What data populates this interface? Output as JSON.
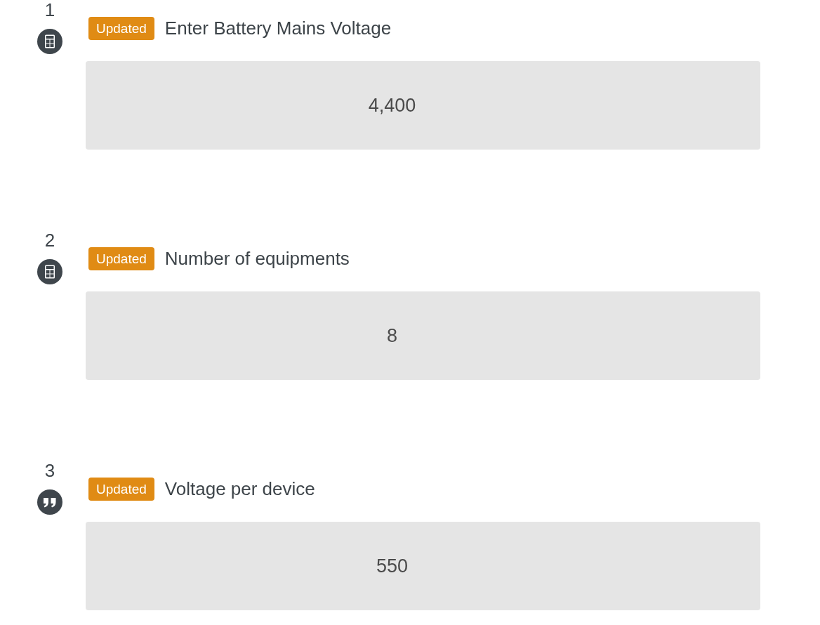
{
  "steps": [
    {
      "number": "1",
      "kind": "calculation",
      "badge": "Updated",
      "title": "Enter Battery Mains Voltage",
      "value": "4,400"
    },
    {
      "number": "2",
      "kind": "calculation",
      "badge": "Updated",
      "title": "Number of equipments",
      "value": "8"
    },
    {
      "number": "3",
      "kind": "text",
      "badge": "Updated",
      "title": "Voltage per device",
      "value": "550"
    }
  ]
}
